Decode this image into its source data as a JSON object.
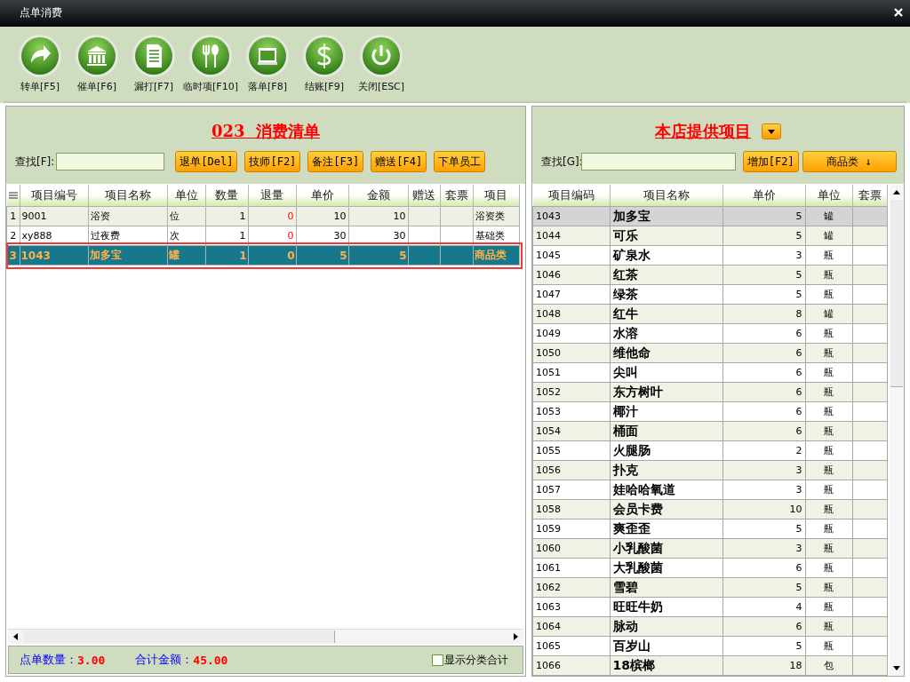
{
  "window": {
    "title": "点单消费"
  },
  "toolbar": [
    {
      "label": "转单[F5]",
      "kind": "forward"
    },
    {
      "label": "催单[F6]",
      "kind": "bank"
    },
    {
      "label": "漏打[F7]",
      "kind": "document"
    },
    {
      "label": "临时项[F10]",
      "kind": "cutlery"
    },
    {
      "label": "落单[F8]",
      "kind": "screen"
    },
    {
      "label": "结账[F9]",
      "kind": "dollar"
    },
    {
      "label": "关闭[ESC]",
      "kind": "power"
    }
  ],
  "order": {
    "title": "023  消费清单",
    "search_label": "查找[F]:",
    "buttons": [
      "退单[Del]",
      "技师[F2]",
      "备注[F3]",
      "赠送[F4]",
      "下单员工"
    ],
    "columns": [
      {
        "label": "项目编号",
        "kind": "text"
      },
      {
        "label": "项目名称",
        "kind": "text"
      },
      {
        "label": "单位",
        "kind": "text"
      },
      {
        "label": "数量",
        "kind": "number"
      },
      {
        "label": "退量",
        "kind": "returned"
      },
      {
        "label": "单价",
        "kind": "number"
      },
      {
        "label": "金额",
        "kind": "number"
      },
      {
        "label": "赠送",
        "kind": "text"
      },
      {
        "label": "套票",
        "kind": "text"
      },
      {
        "label": "项目",
        "kind": "text"
      }
    ],
    "rows": [
      {
        "index": "1",
        "selected": false,
        "highlighted": false,
        "cells": [
          "9001",
          "浴资",
          "位",
          "1",
          "0",
          "10",
          "10",
          null,
          null,
          "浴资类"
        ]
      },
      {
        "index": "2",
        "selected": false,
        "highlighted": false,
        "cells": [
          "xy888",
          "过夜费",
          "次",
          "1",
          "0",
          "30",
          "30",
          null,
          null,
          "基础类"
        ]
      },
      {
        "index": "3",
        "selected": true,
        "highlighted": true,
        "cells": [
          "1043",
          "加多宝",
          "罐",
          "1",
          "0",
          "5",
          "5",
          null,
          null,
          "商品类"
        ]
      }
    ],
    "footer": {
      "count_label": "点单数量：",
      "count": "3.00",
      "total_label": "合计金额：",
      "total": "45.00",
      "show_category_totals": {
        "label": "显示分类合计",
        "checked": false
      }
    }
  },
  "catalog": {
    "title": "本店提供项目",
    "search_label": "查找[G]:",
    "buttons": [
      "增加[F2]",
      "商品类 ↓"
    ],
    "columns": [
      {
        "label": "项目编码",
        "kind": "text"
      },
      {
        "label": "项目名称",
        "kind": "name"
      },
      {
        "label": "单价",
        "kind": "number"
      },
      {
        "label": "单位",
        "kind": "center"
      },
      {
        "label": "套票",
        "kind": "text"
      }
    ],
    "rows": [
      {
        "selected": true,
        "cells": [
          "1043",
          "加多宝",
          "5",
          "罐",
          null
        ]
      },
      {
        "selected": false,
        "cells": [
          "1044",
          "可乐",
          "5",
          "罐",
          null
        ]
      },
      {
        "selected": false,
        "cells": [
          "1045",
          "矿泉水",
          "3",
          "瓶",
          null
        ]
      },
      {
        "selected": false,
        "cells": [
          "1046",
          "红茶",
          "5",
          "瓶",
          null
        ]
      },
      {
        "selected": false,
        "cells": [
          "1047",
          "绿茶",
          "5",
          "瓶",
          null
        ]
      },
      {
        "selected": false,
        "cells": [
          "1048",
          "红牛",
          "8",
          "罐",
          null
        ]
      },
      {
        "selected": false,
        "cells": [
          "1049",
          "水溶",
          "6",
          "瓶",
          null
        ]
      },
      {
        "selected": false,
        "cells": [
          "1050",
          "维他命",
          "6",
          "瓶",
          null
        ]
      },
      {
        "selected": false,
        "cells": [
          "1051",
          "尖叫",
          "6",
          "瓶",
          null
        ]
      },
      {
        "selected": false,
        "cells": [
          "1052",
          "东方树叶",
          "6",
          "瓶",
          null
        ]
      },
      {
        "selected": false,
        "cells": [
          "1053",
          "椰汁",
          "6",
          "瓶",
          null
        ]
      },
      {
        "selected": false,
        "cells": [
          "1054",
          "桶面",
          "6",
          "瓶",
          null
        ]
      },
      {
        "selected": false,
        "cells": [
          "1055",
          "火腿肠",
          "2",
          "瓶",
          null
        ]
      },
      {
        "selected": false,
        "cells": [
          "1056",
          "扑克",
          "3",
          "瓶",
          null
        ]
      },
      {
        "selected": false,
        "cells": [
          "1057",
          "娃哈哈氧道",
          "3",
          "瓶",
          null
        ]
      },
      {
        "selected": false,
        "cells": [
          "1058",
          "会员卡费",
          "10",
          "瓶",
          null
        ]
      },
      {
        "selected": false,
        "cells": [
          "1059",
          "爽歪歪",
          "5",
          "瓶",
          null
        ]
      },
      {
        "selected": false,
        "cells": [
          "1060",
          "小乳酸菌",
          "3",
          "瓶",
          null
        ]
      },
      {
        "selected": false,
        "cells": [
          "1061",
          "大乳酸菌",
          "6",
          "瓶",
          null
        ]
      },
      {
        "selected": false,
        "cells": [
          "1062",
          "雪碧",
          "5",
          "瓶",
          null
        ]
      },
      {
        "selected": false,
        "cells": [
          "1063",
          "旺旺牛奶",
          "4",
          "瓶",
          null
        ]
      },
      {
        "selected": false,
        "cells": [
          "1064",
          "脉动",
          "6",
          "瓶",
          null
        ]
      },
      {
        "selected": false,
        "cells": [
          "1065",
          "百岁山",
          "5",
          "瓶",
          null
        ]
      },
      {
        "selected": false,
        "cells": [
          "1066",
          "18槟榔",
          "18",
          "包",
          null
        ]
      }
    ]
  }
}
